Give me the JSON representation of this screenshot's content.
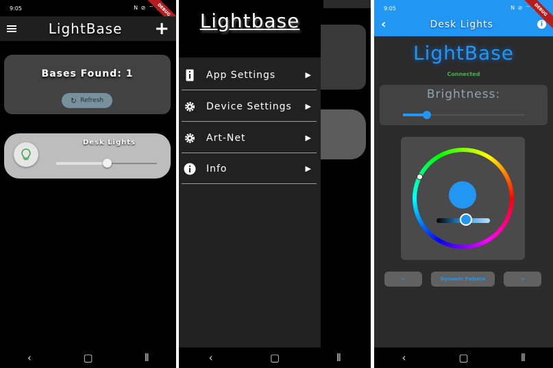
{
  "status_time": "9:05",
  "status_icons": "N ⊘ ⌔ ◢ ▮",
  "debug_label": "DEBUG",
  "screen1": {
    "title": "LightBase",
    "bases_found": "Bases Found: 1",
    "refresh_label": "Refresh",
    "light": {
      "name": "Desk Lights",
      "brightness_fraction": 0.5
    }
  },
  "screen2": {
    "drawer_title": "Lightbase",
    "items": [
      {
        "label": "App Settings",
        "icon": "phone-info-icon"
      },
      {
        "label": "Device Settings",
        "icon": "gear-icon"
      },
      {
        "label": "Art-Net",
        "icon": "gear-icon"
      },
      {
        "label": "Info",
        "icon": "info-icon"
      }
    ]
  },
  "screen3": {
    "title": "Desk Lights",
    "brand": "LightBase",
    "connection_status": "Connected",
    "brightness_label": "Brightness:",
    "brightness_fraction": 0.2,
    "selected_color": "#2196f3",
    "preset_label": "Dynamic Pattern",
    "prev_label": "←",
    "next_label": "→"
  },
  "colors": {
    "accent": "#2196f3",
    "connected": "#4caf50",
    "card": "#424242"
  }
}
